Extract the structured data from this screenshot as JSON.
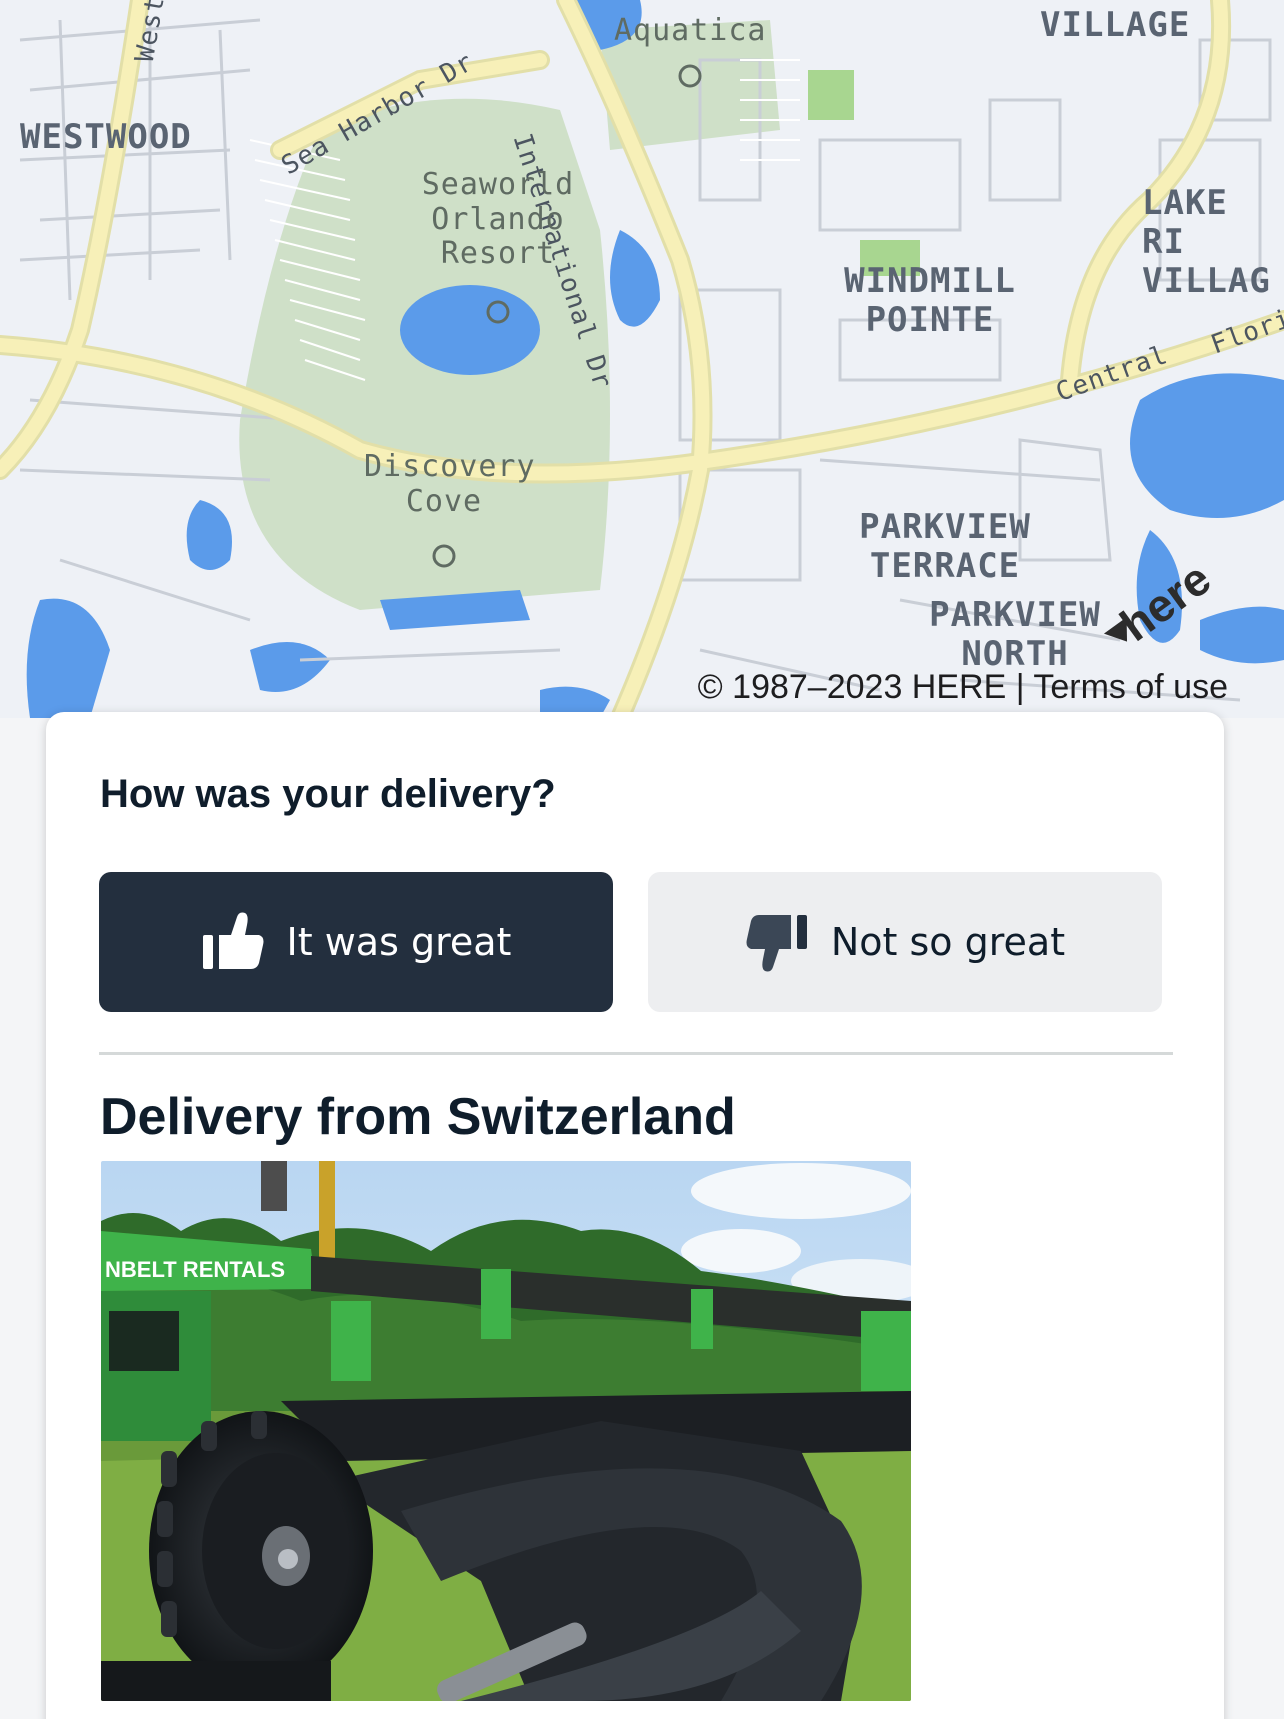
{
  "map": {
    "labels": {
      "west": "West",
      "westwood": "WESTWOOD",
      "sea_harbor": "Sea Harbor Dr",
      "international": "International Dr",
      "aquatica": "Aquatica",
      "village": "VILLAGE",
      "seaworld": "Seaworld Orlando Resort",
      "lake_ri": "LAKE RI VILLAG",
      "windmill": "WINDMILL POINTE",
      "central": "Central",
      "flori": "Flori",
      "discovery": "Discovery Cove",
      "parkview_terrace": "PARKVIEW TERRACE",
      "parkview_north": "PARKVIEW NORTH"
    },
    "logo": "here",
    "copyright": "© 1987–2023 HERE | Terms of use"
  },
  "feedback": {
    "title": "How was your delivery?",
    "great_label": "It was great",
    "not_great_label": "Not so great"
  },
  "delivery": {
    "title": "Delivery from Switzerland",
    "photo_banner_text": "NBELT RENTALS"
  },
  "colors": {
    "map_bg": "#eef1f6",
    "water": "#5b9bea",
    "park": "#cfe0c8",
    "major_road": "#f7f0b8",
    "button_dark": "#232f3e",
    "button_light": "#edeef0"
  }
}
